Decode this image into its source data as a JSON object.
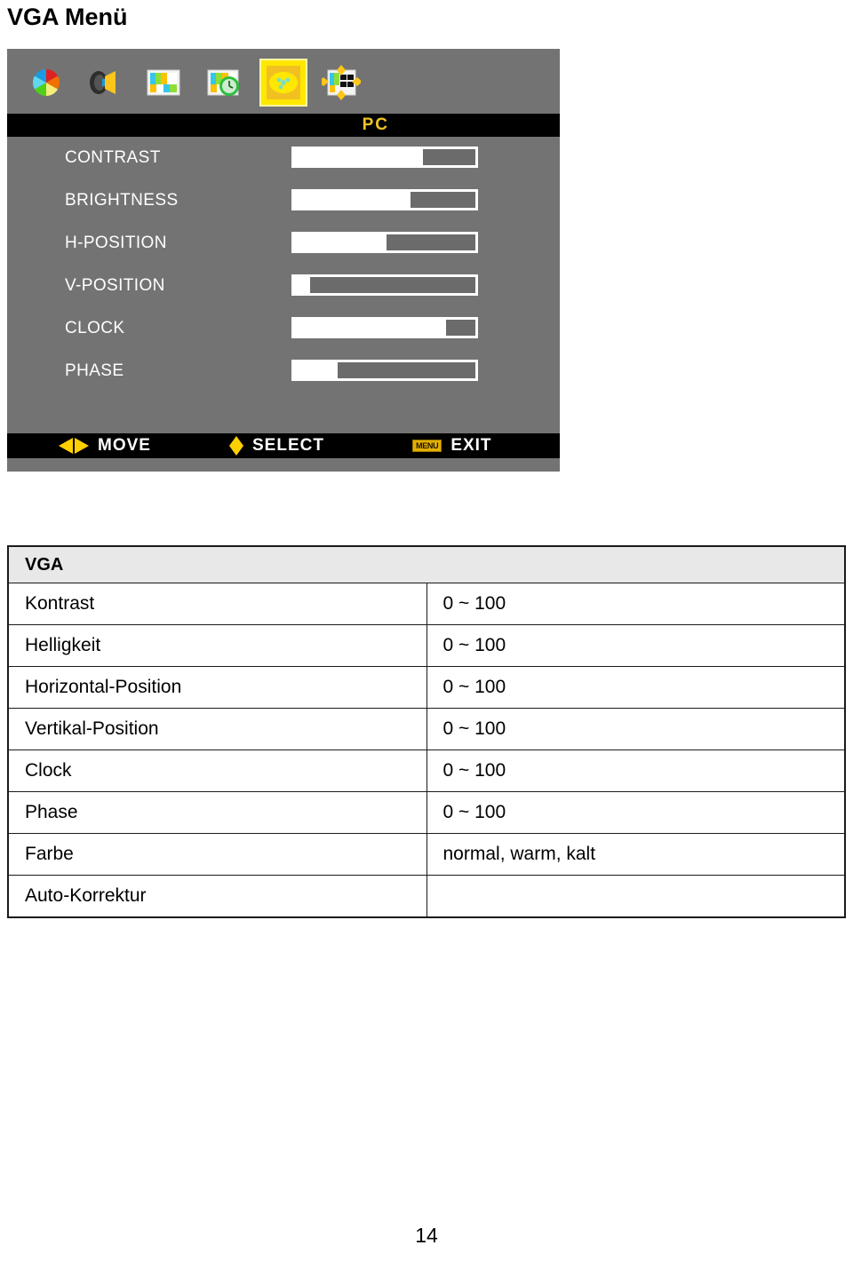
{
  "page": {
    "title": "VGA Menü",
    "number": "14"
  },
  "osd": {
    "source_label": "PC",
    "icons": [
      {
        "name": "color-wheel-icon",
        "selected": false
      },
      {
        "name": "speaker-icon",
        "selected": false
      },
      {
        "name": "picture-icon",
        "selected": false
      },
      {
        "name": "picture-clock-icon",
        "selected": false
      },
      {
        "name": "pc-setup-icon",
        "selected": true
      },
      {
        "name": "osd-position-icon",
        "selected": false
      }
    ],
    "rows": [
      {
        "label": "CONTRAST",
        "value": 71
      },
      {
        "label": "BRIGHTNESS",
        "value": 64
      },
      {
        "label": "H-POSITION",
        "value": 51
      },
      {
        "label": "V-POSITION",
        "value": 9
      },
      {
        "label": "CLOCK",
        "value": 84
      },
      {
        "label": "PHASE",
        "value": 24
      }
    ],
    "footer": [
      {
        "icon": "left-right-arrow-icon",
        "label": "MOVE"
      },
      {
        "icon": "up-down-arrow-icon",
        "label": "SELECT"
      },
      {
        "icon": "menu-button-icon",
        "label": "EXIT",
        "badge": "MENU"
      }
    ],
    "colors": {
      "panel_bg": "#737373",
      "bar_bg": "#000000",
      "accent_yellow": "#ffd000",
      "highlight": "#ffe800",
      "source_text": "#f0c420"
    }
  },
  "table": {
    "header": "VGA",
    "rows": [
      {
        "name": "Kontrast",
        "range": "0 ~ 100"
      },
      {
        "name": "Helligkeit",
        "range": "0 ~ 100"
      },
      {
        "name": "Horizontal-Position",
        "range": "0 ~ 100"
      },
      {
        "name": "Vertikal-Position",
        "range": "0 ~ 100"
      },
      {
        "name": "Clock",
        "range": "0 ~ 100"
      },
      {
        "name": "Phase",
        "range": "0 ~ 100"
      },
      {
        "name": "Farbe",
        "range": "normal, warm, kalt"
      },
      {
        "name": "Auto-Korrektur",
        "range": ""
      }
    ]
  }
}
